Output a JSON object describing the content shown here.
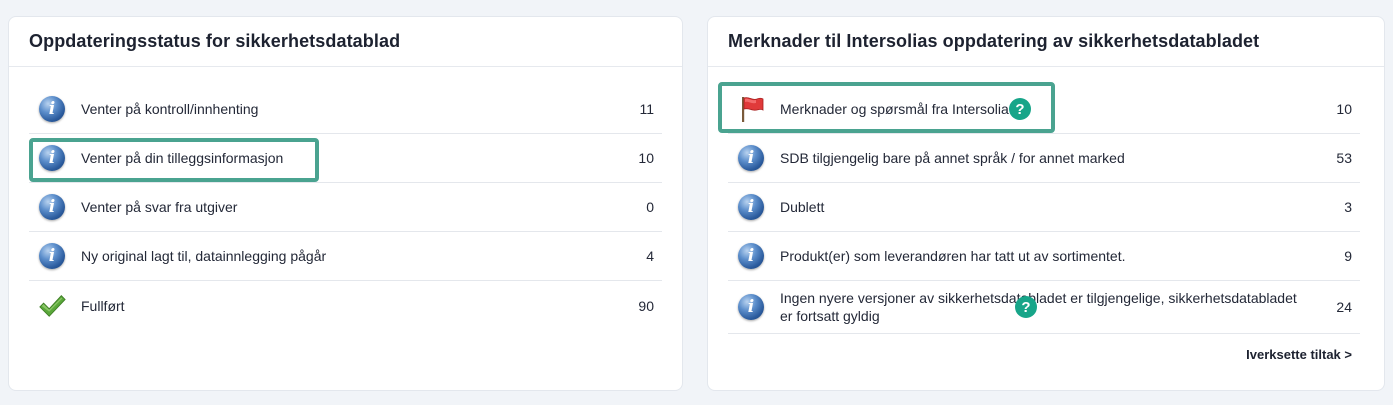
{
  "left_panel": {
    "title": "Oppdateringsstatus for sikkerhetsdatablad",
    "rows": [
      {
        "icon": "info-icon",
        "label": "Venter på kontroll/innhenting",
        "count": "11"
      },
      {
        "icon": "info-icon",
        "label": "Venter på din tilleggsinformasjon",
        "count": "10"
      },
      {
        "icon": "info-icon",
        "label": "Venter på svar fra utgiver",
        "count": "0"
      },
      {
        "icon": "info-icon",
        "label": "Ny original lagt til, datainnlegging pågår",
        "count": "4"
      },
      {
        "icon": "checkmark-icon",
        "label": "Fullført",
        "count": "90"
      }
    ]
  },
  "right_panel": {
    "title": "Merknader til Intersolias oppdatering av sikkerhetsdatabladet",
    "rows": [
      {
        "icon": "red-flag-icon",
        "label": "Merknader og spørsmål fra Intersolia",
        "count": "10"
      },
      {
        "icon": "info-icon",
        "label": "SDB tilgjengelig bare på annet språk / for annet marked",
        "count": "53"
      },
      {
        "icon": "info-icon",
        "label": "Dublett",
        "count": "3"
      },
      {
        "icon": "info-icon",
        "label": "Produkt(er) som leverandøren har tatt ut av sortimentet.",
        "count": "9"
      },
      {
        "icon": "info-icon",
        "label": "Ingen nyere versjoner av sikkerhetsdatabladet er tilgjengelige, sikkerhetsdatabladet er fortsatt gyldig",
        "count": "24"
      }
    ],
    "action_label": "Iverksette tiltak >"
  },
  "help_badge_label": "?",
  "colors": {
    "highlight": "#4aa390",
    "help_badge": "#17a589",
    "flag": "#e03a3a",
    "check": "#5aa83a"
  }
}
